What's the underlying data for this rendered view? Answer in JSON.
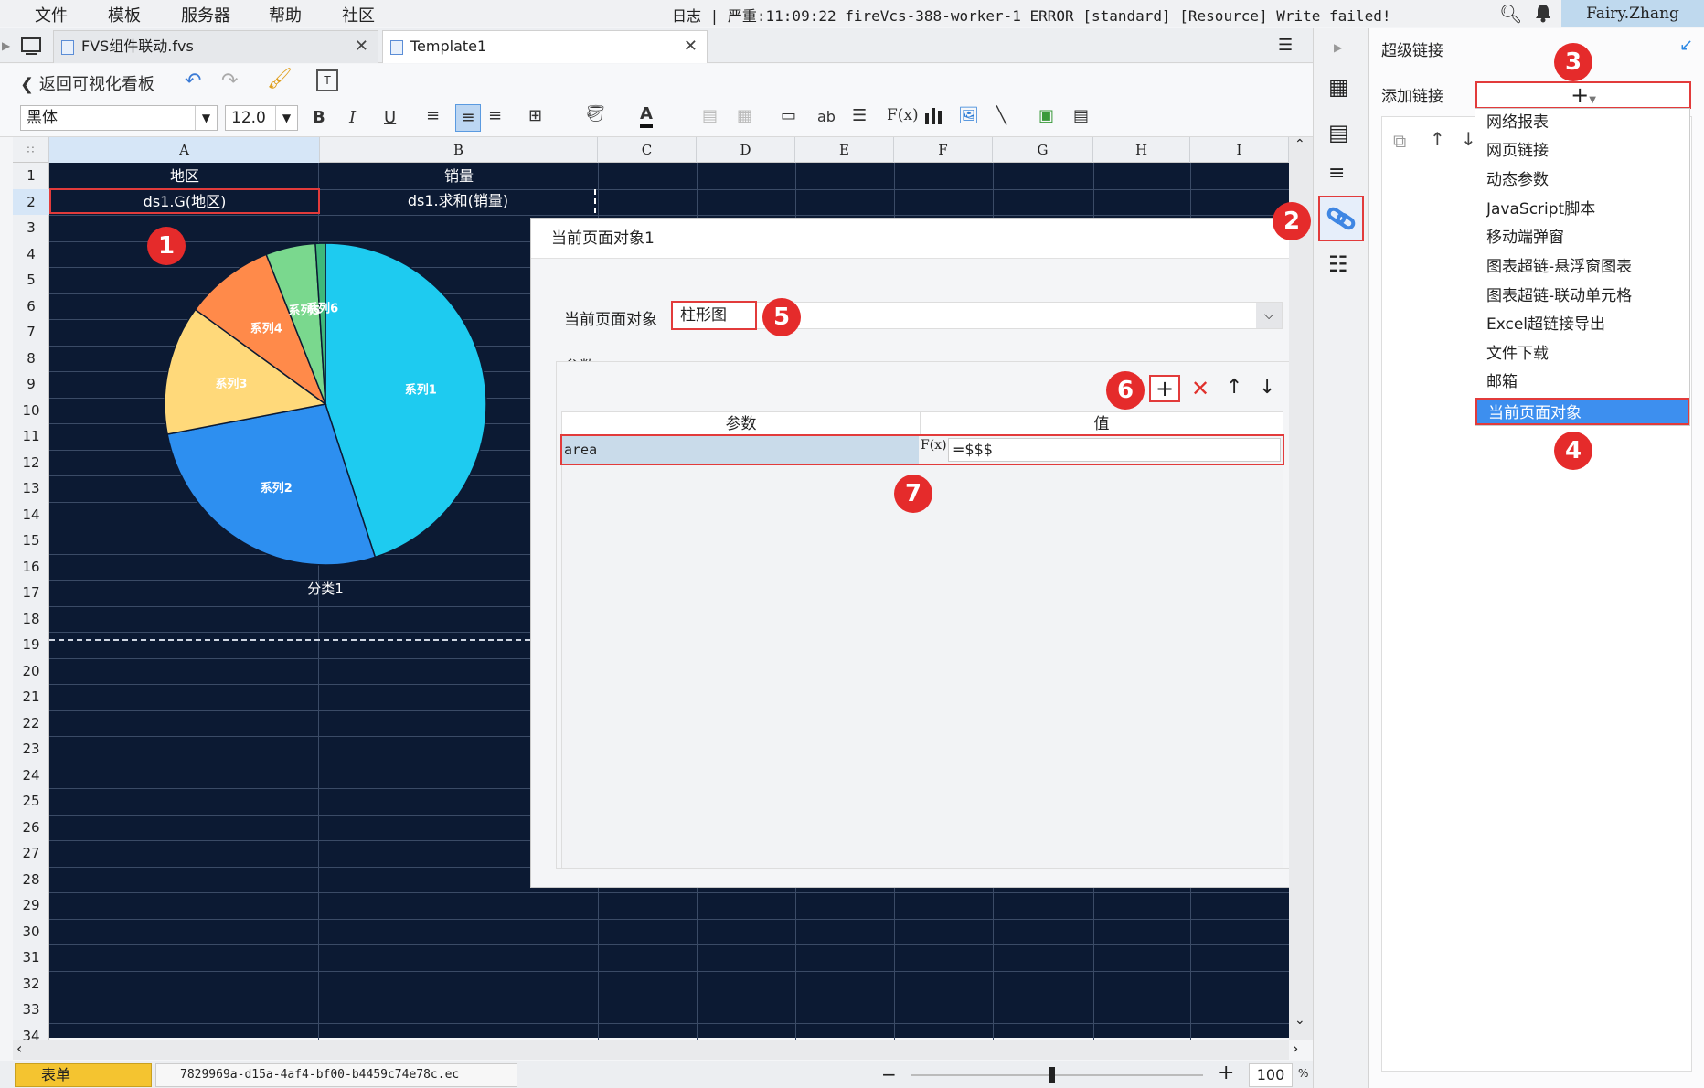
{
  "menu": {
    "items": [
      "文件",
      "模板",
      "服务器",
      "帮助",
      "社区"
    ]
  },
  "log": {
    "text": "日志 | 严重:11:09:22 fireVcs-388-worker-1 ERROR [standard] [Resource] Write failed!"
  },
  "user": {
    "name": "Fairy.Zhang"
  },
  "tabs": [
    {
      "label": "FVS组件联动.fvs"
    },
    {
      "label": "Template1"
    }
  ],
  "toolbar": {
    "back_label": "返回可视化看板",
    "font_name": "黑体",
    "font_size": "12.0"
  },
  "grid": {
    "columns": [
      "A",
      "B",
      "C",
      "D",
      "E",
      "F",
      "G",
      "H",
      "I"
    ],
    "rows": [
      "1",
      "2",
      "3",
      "4",
      "5",
      "6",
      "7",
      "8",
      "9",
      "10",
      "11",
      "12",
      "13",
      "14",
      "15",
      "16",
      "17",
      "18",
      "19",
      "20",
      "21",
      "22",
      "23",
      "24",
      "25",
      "26",
      "27",
      "28",
      "29",
      "30",
      "31",
      "32",
      "33",
      "34"
    ],
    "header_cells": [
      "地区",
      "销量"
    ],
    "data_cells": [
      "ds1.G(地区)",
      "ds1.求和(销量)"
    ]
  },
  "chart_data": {
    "type": "pie",
    "categories": [
      "系列1",
      "系列2",
      "系列3",
      "系列4",
      "系列5",
      "系列6"
    ],
    "values": [
      45,
      27,
      13,
      9,
      5,
      1
    ],
    "xlabel": "分类1",
    "colors": [
      "#1ecbf0",
      "#2d8ff0",
      "#ffd97a",
      "#ff8a4a",
      "#7ad88e",
      "#3fb87a"
    ]
  },
  "dialog": {
    "title": "当前页面对象1",
    "object_label": "当前页面对象",
    "object_value": "柱形图",
    "params_label": "参数",
    "col_param": "参数",
    "col_value": "值",
    "row_param": "area",
    "row_value": "=$$$",
    "fx_label": "F(x)"
  },
  "rightpanel": {
    "title": "超级链接",
    "add_label": "添加链接",
    "dropdown_items": [
      "网络报表",
      "网页链接",
      "动态参数",
      "JavaScript脚本",
      "移动端弹窗",
      "图表超链-悬浮窗图表",
      "图表超链-联动单元格",
      "Excel超链接导出",
      "文件下载",
      "邮箱",
      "当前页面对象"
    ]
  },
  "badges": [
    "1",
    "2",
    "3",
    "4",
    "5",
    "6",
    "7"
  ],
  "bottom": {
    "sheet_tab": "表单",
    "file_label": "7829969a-d15a-4af4-bf00-b4459c74e78c.ec",
    "zoom_value": "100",
    "zoom_unit": "%"
  },
  "colors": {
    "accent": "#2b87e3",
    "highlight_red": "#e23b3b",
    "grid_bg": "#0c1a33",
    "selected": "#3d8fef"
  }
}
